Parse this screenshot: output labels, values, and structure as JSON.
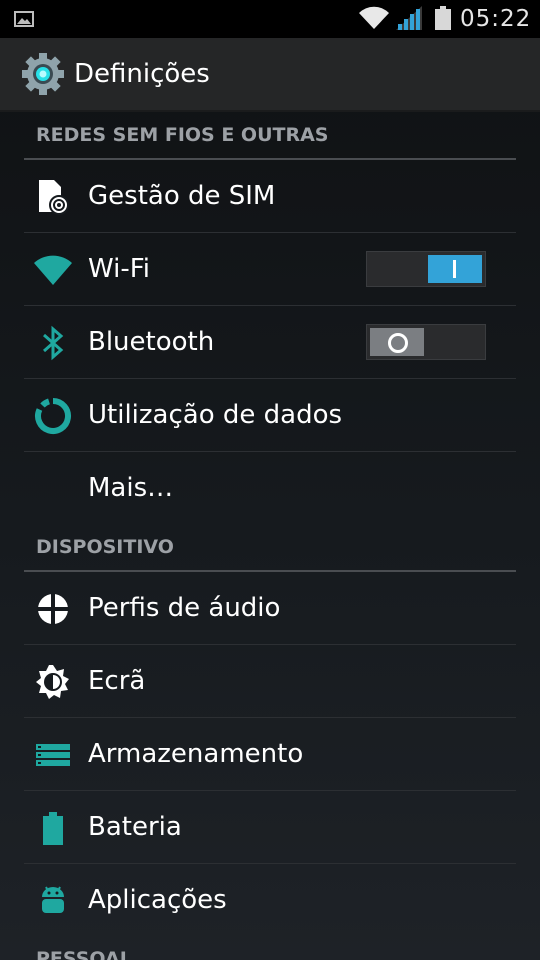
{
  "status_bar": {
    "time": "05:22",
    "icons": [
      "image-notification-icon",
      "wifi-signal-icon",
      "cell-signal-icon",
      "battery-icon"
    ]
  },
  "action_bar": {
    "title": "Definições",
    "icon": "settings-gear-icon"
  },
  "colors": {
    "accent_teal": "#1fa8a0",
    "toggle_on": "#33a3d8",
    "section_header": "#9da1a6"
  },
  "sections": [
    {
      "header": "REDES SEM FIOS E OUTRAS",
      "items": [
        {
          "label": "Gestão de SIM",
          "icon": "sim-management-icon"
        },
        {
          "label": "Wi-Fi",
          "icon": "wifi-icon",
          "toggle": "on"
        },
        {
          "label": "Bluetooth",
          "icon": "bluetooth-icon",
          "toggle": "off"
        },
        {
          "label": "Utilização de dados",
          "icon": "data-usage-icon"
        },
        {
          "label": "Mais…"
        }
      ]
    },
    {
      "header": "DISPOSITIVO",
      "items": [
        {
          "label": "Perfis de áudio",
          "icon": "audio-profiles-icon"
        },
        {
          "label": "Ecrã",
          "icon": "display-brightness-icon"
        },
        {
          "label": "Armazenamento",
          "icon": "storage-icon"
        },
        {
          "label": "Bateria",
          "icon": "battery-icon"
        },
        {
          "label": "Aplicações",
          "icon": "android-apps-icon"
        }
      ]
    },
    {
      "header": "PESSOAL"
    }
  ]
}
